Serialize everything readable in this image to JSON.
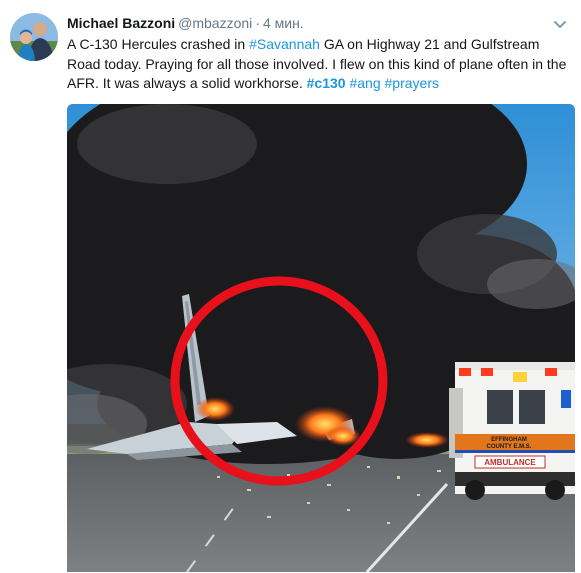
{
  "tweet": {
    "author_name": "Michael Bazzoni",
    "handle": "@mbazzoni",
    "separator": "·",
    "time": "4 мин.",
    "text_parts": {
      "p1": "A C-130 Hercules crashed in ",
      "hashtag_savannah": "#Savannah",
      "p2": " GA on Highway 21 and Gulfstream Road today. Praying for all those involved. I flew on this kind of plane often in the AFR. It was always a solid workhorse. ",
      "hashtag_c130": "#c130",
      "space1": " ",
      "hashtag_ang": "#ang",
      "space2": " ",
      "hashtag_prayers": "#prayers"
    }
  },
  "media": {
    "ambulance_label_line1": "EFFINGHAM",
    "ambulance_label_line2": "COUNTY E.M.S.",
    "ambulance_label_line3": "AMBULANCE"
  },
  "colors": {
    "link": "#1b95e0",
    "secondary_text": "#657786",
    "circle_red": "#e8101a"
  },
  "icons": {
    "caret": "chevron-down-icon"
  }
}
